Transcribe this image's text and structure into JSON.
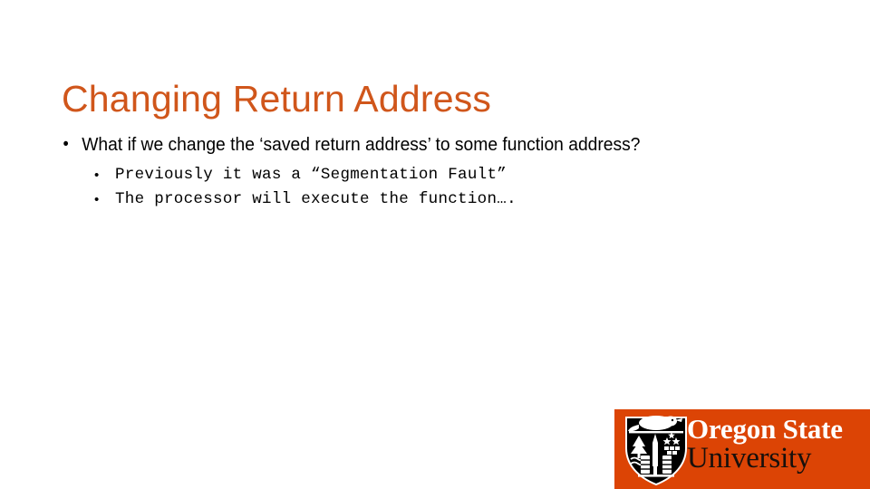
{
  "slide": {
    "title": "Changing Return Address",
    "title_color": "#D0561B",
    "background_color": "#FFFFFF",
    "bullets": [
      {
        "level": 1,
        "marker": "•",
        "text": "What if we change the ‘saved return address’ to some function address?"
      },
      {
        "level": 2,
        "marker": "•",
        "text": "Previously it was a “Segmentation Fault”"
      },
      {
        "level": 2,
        "marker": "•",
        "text": "The processor will execute the function…."
      }
    ]
  },
  "logo": {
    "name": "oregon-state-university-logo",
    "block_color": "#DC4405",
    "line1": "Oregon State",
    "line1_color": "#FFFFFF",
    "line2": "University",
    "line2_color": "#17100C",
    "shield_icon": "osu-beaver-shield-icon"
  }
}
